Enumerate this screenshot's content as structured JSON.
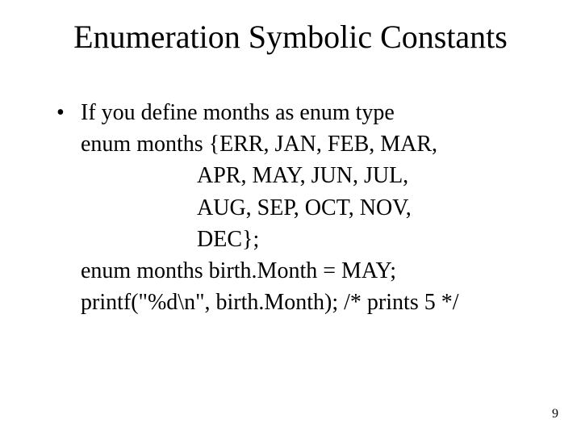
{
  "title": "Enumeration Symbolic Constants",
  "bullet": {
    "mark": "•",
    "line1": "If you define months as enum type",
    "line2": "enum months {ERR, JAN, FEB, MAR,",
    "line3": "APR, MAY, JUN, JUL,",
    "line4": "AUG, SEP, OCT, NOV,",
    "line5": "DEC};",
    "line6": "enum months birth.Month = MAY;",
    "line7": "printf(\"%d\\n\", birth.Month);    /* prints 5 */"
  },
  "page_number": "9"
}
